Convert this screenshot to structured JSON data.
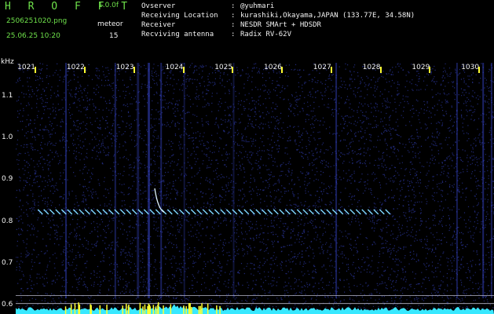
{
  "header": {
    "brand": "H R O F F T",
    "version": "1.0.0f",
    "filename": "2506251020.png",
    "mode": "meteor",
    "datetime": "25.06.25 10:20",
    "count": "15"
  },
  "station": {
    "rows": [
      {
        "label": "Ovserver",
        "value": "@yuhmari"
      },
      {
        "label": "Receiving Location",
        "value": "kurashiki,Okayama,JAPAN (133.77E, 34.58N)"
      },
      {
        "label": "Receiver",
        "value": "NESDR SMArt + HDSDR"
      },
      {
        "label": "Recviving antenna",
        "value": "Radix RV-62V"
      }
    ]
  },
  "axes": {
    "freq_unit": "kHz",
    "freq_ticks": [
      "1021",
      "1022",
      "1023",
      "1024",
      "1025",
      "1026",
      "1027",
      "1028",
      "1029",
      "1030"
    ],
    "freq_range": [
      1020.6,
      1030.3
    ],
    "time_ticks": [
      "1.1",
      "1.0",
      "0.9",
      "0.8",
      "0.7",
      "0.6"
    ],
    "time_range": [
      1.18,
      0.58
    ]
  },
  "colors": {
    "text_green": "#6ee04a",
    "text_white": "#f2f2f2",
    "tick_yellow": "#ffff30",
    "level_cyan": "#38e8ff",
    "noise_blue": "#3a4ad8",
    "echo_cyan": "#7fd8ff"
  },
  "spectrogram": {
    "echo_trace": {
      "freq_start": 1021.05,
      "freq_end": 1028.15,
      "time": 0.824
    },
    "head_echo": {
      "freq": 1023.42,
      "time_start": 0.88,
      "time_end": 0.823
    },
    "reference_lines": [
      0.624,
      0.605
    ]
  }
}
